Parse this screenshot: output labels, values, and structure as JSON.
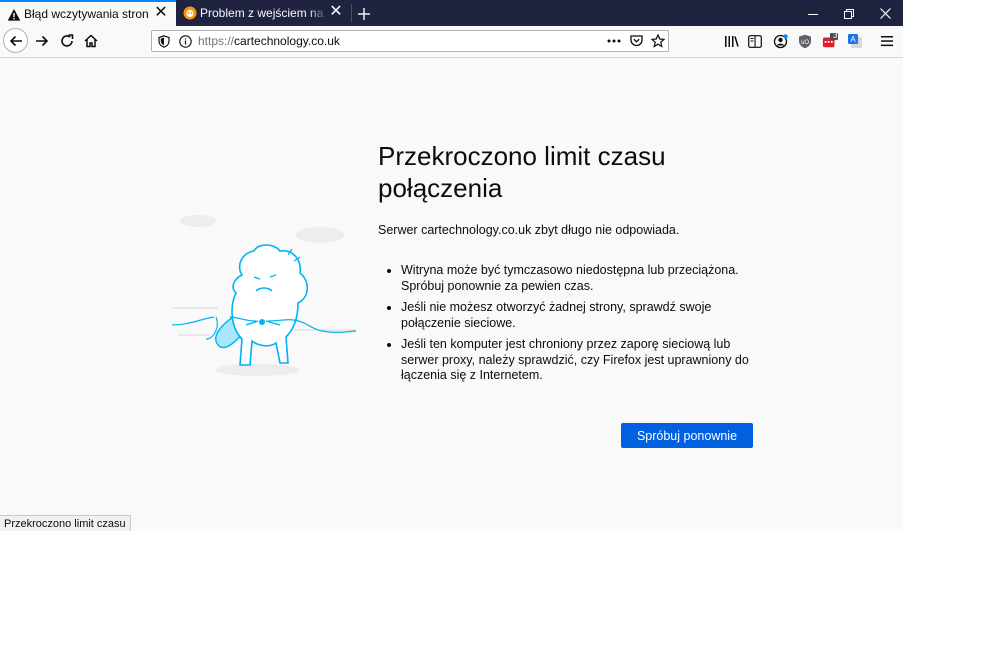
{
  "tabs": [
    {
      "title": "Błąd wczytywania strony",
      "icon": "warning-icon",
      "active": true
    },
    {
      "title": "Problem z wejściem na stronę 'cartechnology.co.uk'",
      "icon": "support-forum-icon",
      "active": false
    }
  ],
  "navbar": {
    "url_scheme": "https://",
    "url_host": "cartechnology.co.uk",
    "extension_badge": "3"
  },
  "error_page": {
    "title": "Przekroczono limit czasu połączenia",
    "description": "Serwer cartechnology.co.uk zbyt długo nie odpowiada.",
    "items": [
      "Witryna może być tymczasowo niedostępna lub przeciążona. Spróbuj ponownie za pewien czas.",
      "Jeśli nie możesz otworzyć żadnej strony, sprawdź swoje połączenie sieciowe.",
      "Jeśli ten komputer jest chroniony przez zaporę sieciową lub serwer proxy, należy sprawdzić, czy Firefox jest uprawniony do łączenia się z Internetem."
    ],
    "retry_label": "Spróbuj ponownie"
  },
  "status_text": "Przekroczono limit czasu",
  "colors": {
    "tabbar": "#202340",
    "accent": "#0a84ff",
    "button": "#0060df",
    "illustration": "#00b3f4"
  }
}
